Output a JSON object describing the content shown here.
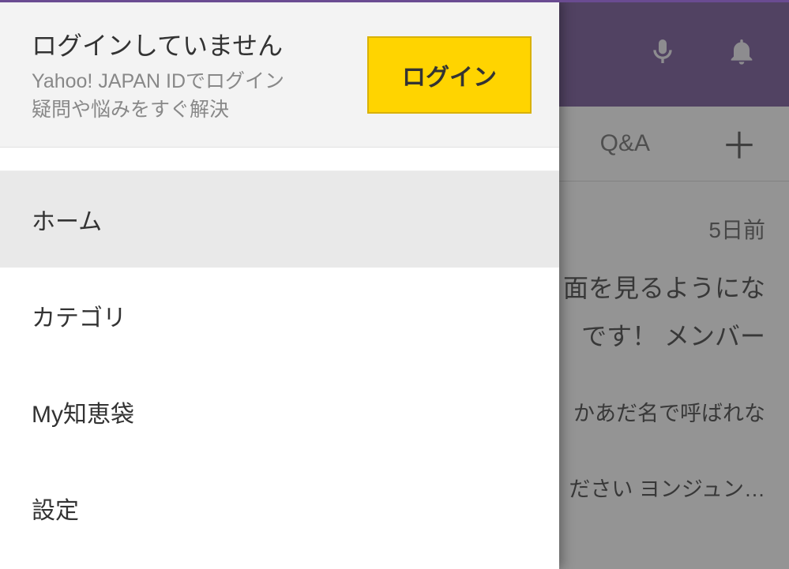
{
  "drawer": {
    "title": "ログインしていません",
    "sub_line1": "Yahoo! JAPAN IDでログイン",
    "sub_line2": "疑問や悩みをすぐ解決",
    "login_button": "ログイン",
    "menu": {
      "home": "ホーム",
      "category": "カテゴリ",
      "my_chiebukuro": "My知恵袋",
      "settings": "設定"
    }
  },
  "background": {
    "tab_label": "Q&A",
    "plus": "＋",
    "time_ago": "5日前",
    "content_line1": "面を見るようにな",
    "content_line2": "です！ メンバー",
    "content_line3": "かあだ名で呼ばれな",
    "content_line4": "ださい ヨンジュン…"
  }
}
